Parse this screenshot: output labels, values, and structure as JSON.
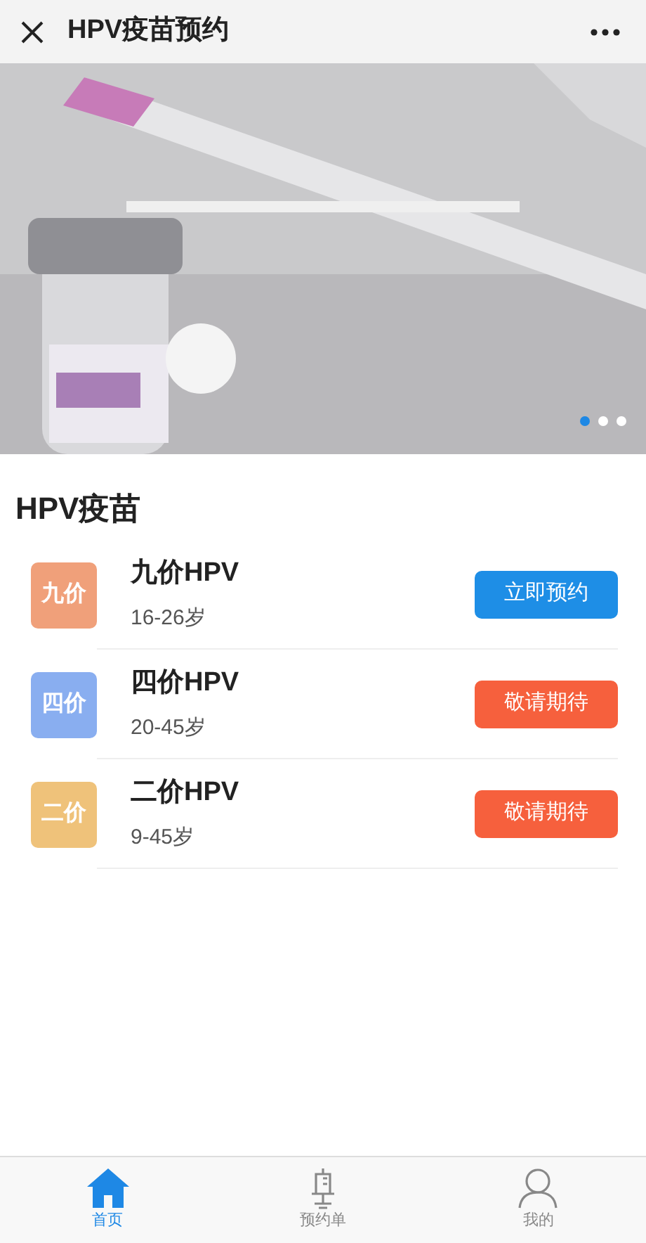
{
  "header": {
    "title": "HPV疫苗预约"
  },
  "banner": {
    "kind": "picture",
    "dots": [
      {
        "selected": true
      },
      {
        "selected": false
      },
      {
        "selected": false
      }
    ]
  },
  "section": {
    "title": "HPV疫苗"
  },
  "vaccines": [
    {
      "badge": "九价",
      "color": "#f0a07a",
      "name": "九价HPV",
      "ages": "16-26岁",
      "action": {
        "kind": "available",
        "label": "立即预约"
      }
    },
    {
      "badge": "四价",
      "color": "#89aef0",
      "name": "四价HPV",
      "ages": "20-45岁",
      "action": {
        "kind": "pending",
        "label": "敬请期待"
      }
    },
    {
      "badge": "二价",
      "color": "#efc27a",
      "name": "二价HPV",
      "ages": "9-45岁",
      "action": {
        "kind": "pending",
        "label": "敬请期待"
      }
    }
  ],
  "tabbar": [
    {
      "kind": "home",
      "label": "首页",
      "selected": true
    },
    {
      "kind": "syringe",
      "label": "预约单",
      "selected": false
    },
    {
      "kind": "user",
      "label": "我的",
      "selected": false
    }
  ]
}
